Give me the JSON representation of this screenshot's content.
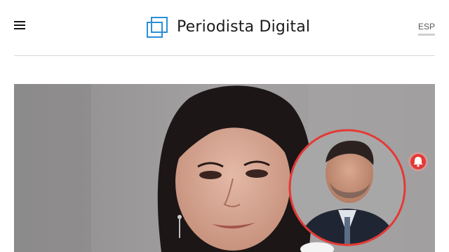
{
  "header": {
    "menu_icon": "hamburger-menu-icon",
    "brand": "Periodista Digital",
    "language": "ESP"
  },
  "hero": {
    "image": "news-photo-woman-with-inset-portrait-of-man",
    "inset_ring_color": "#e53935"
  },
  "notification": {
    "icon": "bell-icon",
    "color": "#e53935"
  },
  "colors": {
    "brand_blue": "#2a8fd8",
    "divider": "#d6d6d6"
  }
}
